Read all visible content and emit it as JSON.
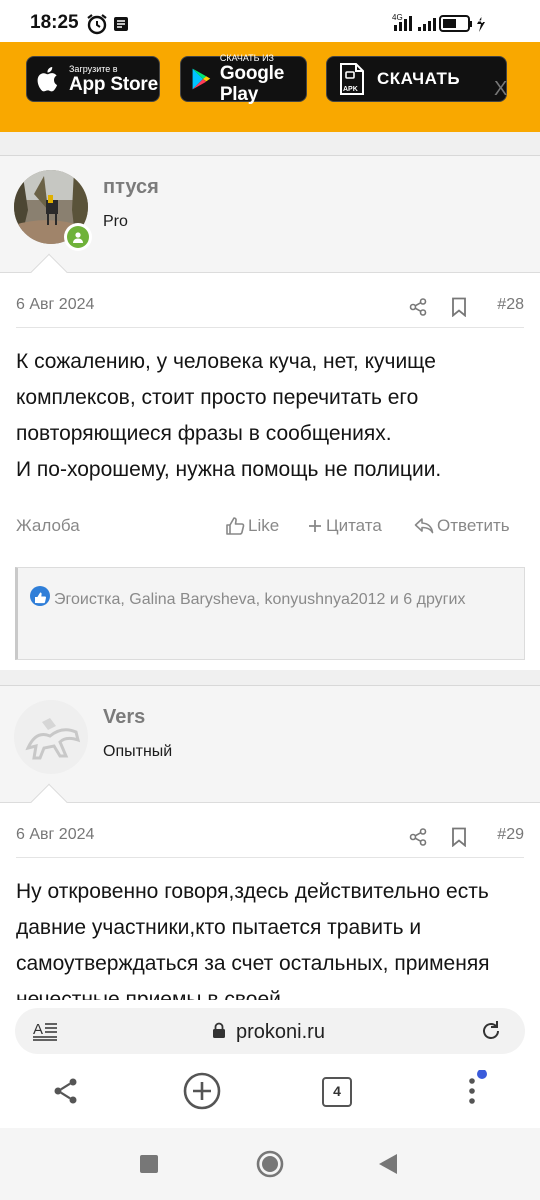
{
  "status": {
    "time": "18:25",
    "net_label": "4G",
    "battery": "44"
  },
  "promo": {
    "appstore_small": "Загрузите в",
    "appstore_big": "App Store",
    "gplay_small": "СКАЧАТЬ ИЗ",
    "gplay_big": "Google Play",
    "apk_badge": "APK",
    "apk_label": "СКАЧАТЬ",
    "close_label": "X"
  },
  "posts": [
    {
      "username": "птуся",
      "user_title": "Pro",
      "date": "6 Авг 2024",
      "post_number": "#28",
      "body": [
        "К сожалению, у человека куча, нет, кучище комплексов, стоит просто перечитать его повторяющиеся фразы в сообщениях.",
        "И по-хорошему, нужна помощь не полиции."
      ],
      "report_label": "Жалоба",
      "like_label": "Like",
      "quote_label": "Цитата",
      "reply_label": "Ответить",
      "reactions_text": "Эгоистка, Galina Barysheva, konyushnya2012 и 6 других"
    },
    {
      "username": "Vers",
      "user_title": "Опытный",
      "date": "6 Авг 2024",
      "post_number": "#29",
      "body": [
        "Ну откровенно говоря,здесь действительно есть давние участники,кто пытается травить и самоутверждаться за счет остальных, применяя нечестные приемы в своей"
      ]
    }
  ],
  "browser": {
    "url": "prokoni.ru",
    "tab_count": "4"
  },
  "colors": {
    "promo_bg": "#f9a800",
    "online_green": "#6fb23a",
    "like_blue": "#2f7ed8",
    "notify_dot": "#3b5bdb"
  }
}
